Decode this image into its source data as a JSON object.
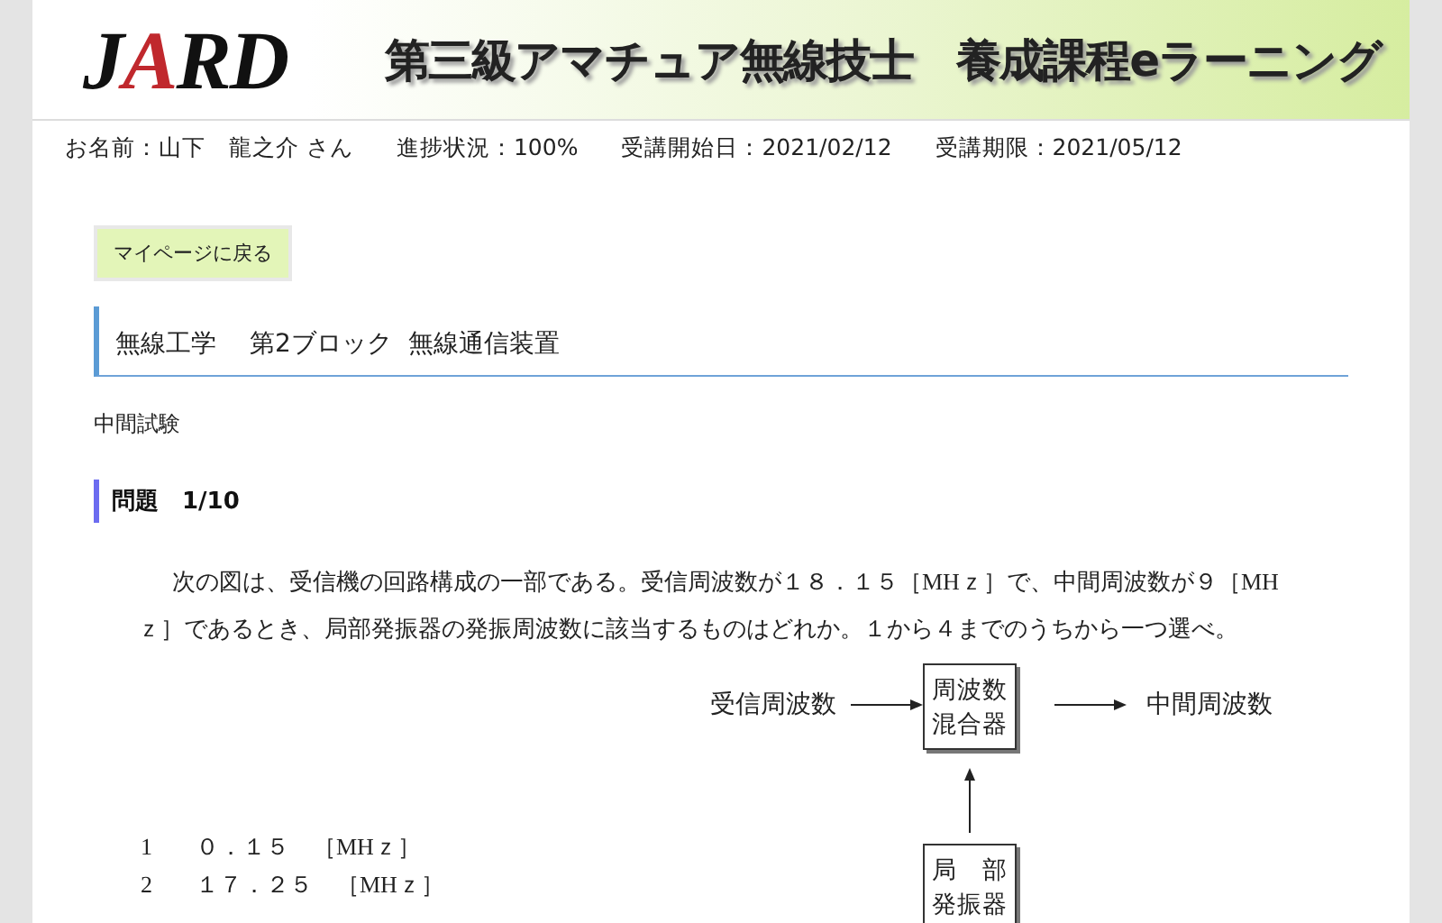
{
  "header": {
    "logo": "JARD",
    "title": "第三級アマチュア無線技士　養成課程eラーニング"
  },
  "info": [
    {
      "label": "お名前：",
      "value": "山下　龍之介 さん"
    },
    {
      "label": "進捗状況：",
      "value": "100%"
    },
    {
      "label": "受講開始日：",
      "value": "2021/02/12"
    },
    {
      "label": "受講期限：",
      "value": "2021/05/12"
    }
  ],
  "back_button": "マイページに戻る",
  "section_heading": "無線工学　 第2ブロック  無線通信装置",
  "exam_label": "中間試験",
  "question": {
    "number": "問題　1/10",
    "text": "次の図は、受信機の回路構成の一部である。受信周波数が１８．１５［MHｚ］で、中間周波数が９［MHｚ］であるとき、局部発振器の発振周波数に該当するものはどれか。１から４までのうちから一つ選べ。",
    "diagram": {
      "input_label": "受信周波数",
      "mixer": [
        "周波数",
        "混合器"
      ],
      "output_label": "中間周波数",
      "oscillator": [
        "局　部",
        "発振器"
      ]
    },
    "options": [
      {
        "number": "1",
        "value": "０．１５　［MHｚ］"
      },
      {
        "number": "2",
        "value": "１７．２５　［MHｚ］"
      }
    ]
  }
}
